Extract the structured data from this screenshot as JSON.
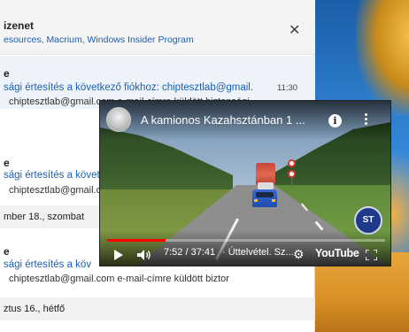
{
  "mail": {
    "header": {
      "title": "izenet",
      "subtitle": "esources, Macrium, Windows Insider Program"
    },
    "items": [
      {
        "group_label": "e",
        "subject": "sági értesítés a következő fiókhoz: chiptesztlab@gmail.",
        "time": "11:30",
        "preview": "chiptesztlab@gmail.com e-mail-címre küldött biztonsági"
      },
      {
        "group_label": "e",
        "subject": "sági értesítés a követ",
        "preview": "chiptesztlab@gmail.com e-mail-címre küldött biztor"
      },
      {
        "group_label": "e",
        "subject": "sági értesítés a köv",
        "preview": "chiptesztlab@gmail.com e-mail-címre küldött biztor"
      }
    ],
    "dates": {
      "date1": "mber 18., szombat",
      "date2": "ztus 16., hétfő"
    }
  },
  "video": {
    "title": "A kamionos Kazahsztánban 1 ...",
    "time_current": "7:52",
    "time_total": "37:41",
    "time_display": "7:52 / 37:41",
    "chapter": "· Úttelvétel. Sz...",
    "brand": "YouTube",
    "watermark_text": "ST",
    "progress_fraction": 0.21,
    "accent_color": "#ff0000"
  },
  "icons": {
    "close": "close-icon",
    "info": "info-icon",
    "more": "more-vert-icon",
    "play": "play-icon",
    "volume": "volume-icon",
    "settings": "gear-icon",
    "fullscreen": "fullscreen-icon"
  }
}
